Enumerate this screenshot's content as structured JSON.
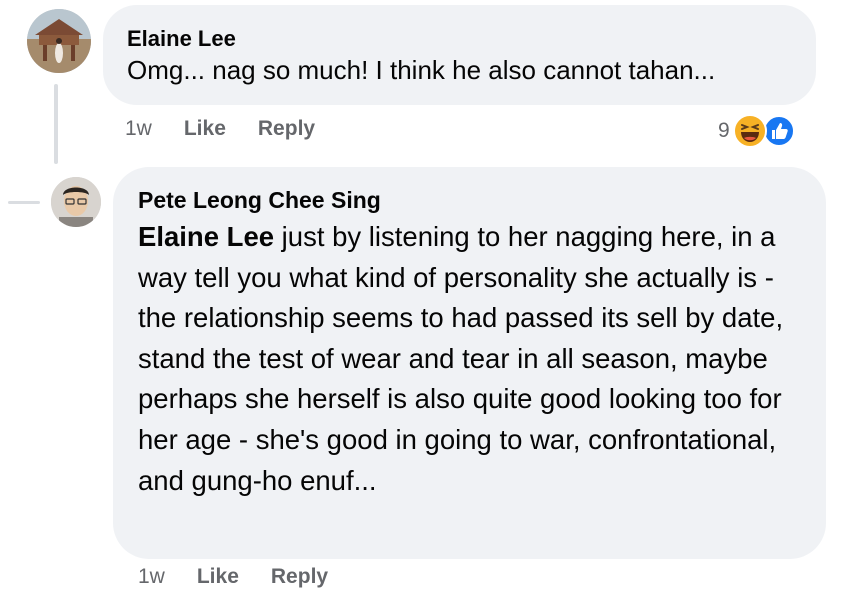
{
  "comments": [
    {
      "author": "Elaine Lee",
      "text": "Omg... nag so much! I think he also cannot tahan...",
      "time": "1w",
      "like_label": "Like",
      "reply_label": "Reply",
      "reaction_count": "9",
      "reactions": [
        "haha-icon",
        "like-icon"
      ]
    },
    {
      "author": "Pete Leong Chee Sing",
      "mention": "Elaine Lee",
      "text": " just by listening to her nagging here, in a way tell you what kind of personality she actually is - the relationship seems to had passed its sell by date, stand the test of wear and tear in all season, maybe perhaps she herself is also quite good looking too for her age - she's good in going to war, confrontational, and gung-ho enuf...",
      "time": "1w",
      "like_label": "Like",
      "reply_label": "Reply"
    }
  ],
  "colors": {
    "bubble": "#f0f2f5",
    "secondary_text": "#65676b",
    "like_blue": "#1877f2",
    "haha_yellow": "#f7b125"
  }
}
